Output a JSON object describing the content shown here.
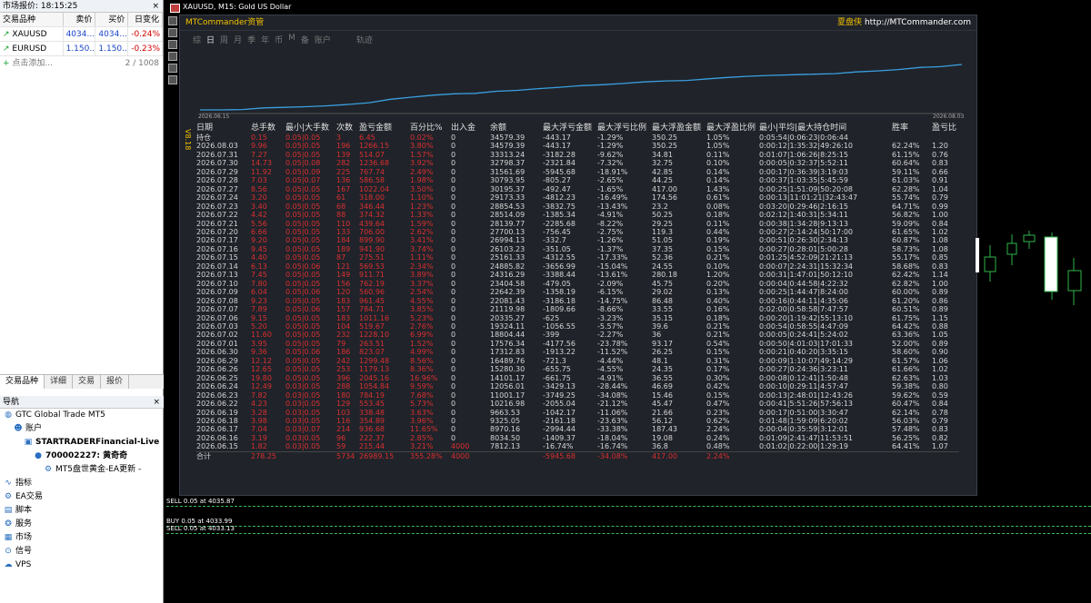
{
  "market_watch": {
    "title": "市场报价: 18:15:25",
    "close": "×",
    "headers": [
      "交易品种",
      "卖价",
      "买价",
      "日变化"
    ],
    "rows": [
      {
        "symbol": "XAUUSD",
        "bid": "4034...",
        "ask": "4034...",
        "change": "-0.24%"
      },
      {
        "symbol": "EURUSD",
        "bid": "1.150...",
        "ask": "1.150...",
        "change": "-0.23%"
      }
    ],
    "add": "点击添加...",
    "count": "2 / 1008",
    "tabs": [
      "交易品种",
      "详细",
      "交易",
      "报价"
    ]
  },
  "navigator": {
    "title": "导航",
    "close": "×",
    "items": [
      {
        "level": 0,
        "icon": "globe-icon",
        "label": "GTC Global Trade MT5"
      },
      {
        "level": 1,
        "icon": "accounts-icon",
        "label": "账户"
      },
      {
        "level": 2,
        "icon": "server-icon",
        "label": "STARTRADERFinancial-Live",
        "bold": true
      },
      {
        "level": 3,
        "icon": "user-icon",
        "label": "700002227: 黄奇奇",
        "bold": true
      },
      {
        "level": 4,
        "icon": "ea-icon",
        "label": "MT5盘世黄金-EA更新 -"
      },
      {
        "level": 0,
        "icon": "indicator-icon",
        "label": "指标"
      },
      {
        "level": 0,
        "icon": "ea-icon",
        "label": "EA交易"
      },
      {
        "level": 0,
        "icon": "script-icon",
        "label": "脚本"
      },
      {
        "level": 0,
        "icon": "service-icon",
        "label": "服务"
      },
      {
        "level": 0,
        "icon": "market-icon",
        "label": "市场"
      },
      {
        "level": 0,
        "icon": "signal-icon",
        "label": "信号"
      },
      {
        "level": 0,
        "icon": "vps-icon",
        "label": "VPS"
      }
    ]
  },
  "chart": {
    "title": "XAUUSD, M15:  Gold US Dollar"
  },
  "mtc": {
    "title": "MTCommander资管",
    "brand": "夏盘侠",
    "url": "http://MTCommander.com",
    "nav": [
      "综",
      "日",
      "周",
      "月",
      "季",
      "年",
      "币",
      "M",
      "备",
      "账户"
    ],
    "nav_selected": "日",
    "track": "轨迹",
    "date_start": "2026.06.15",
    "date_end": "2026.08.03",
    "version": "V8.18",
    "headers": [
      "日期",
      "总手数",
      "最小|大手数",
      "次数",
      "盈亏金额",
      "百分比%",
      "出入金",
      "余额",
      "最大浮亏金额",
      "最大浮亏比例",
      "最大浮盈金额",
      "最大浮盈比例",
      "最小|平均|最大持仓时间",
      "胜率",
      "盈亏比"
    ],
    "rows": [
      [
        "持仓",
        "0.15",
        "0.05|0.05",
        "3",
        "6.45",
        "0.02%",
        "0",
        "34579.39",
        "-443.17",
        "-1.29%",
        "350.25",
        "1.05%",
        "0:05:54|0:06:23|0:06:44",
        "",
        ""
      ],
      [
        "2026.08.03",
        "9.96",
        "0.05|0.05",
        "196",
        "1266.15",
        "3.80%",
        "0",
        "34579.39",
        "-443.17",
        "-1.29%",
        "350.25",
        "1.05%",
        "0:00:12|1:35:32|49:26:10",
        "62.24%",
        "1.20"
      ],
      [
        "2026.07.31",
        "7.27",
        "0.05|0.05",
        "139",
        "514.07",
        "1.57%",
        "0",
        "33313.24",
        "-3182.28",
        "-9.62%",
        "34.81",
        "0.11%",
        "0:01:07|1:06:26|8:25:15",
        "61.15%",
        "0.76"
      ],
      [
        "2026.07.30",
        "14.73",
        "0.05|0.08",
        "282",
        "1236.68",
        "3.92%",
        "0",
        "32798.37",
        "-2321.84",
        "-7.32%",
        "32.75",
        "0.10%",
        "0:00:05|0:32:37|5:52:11",
        "60.64%",
        "0.83"
      ],
      [
        "2026.07.29",
        "11.92",
        "0.05|0.09",
        "225",
        "767.74",
        "2.49%",
        "0",
        "31561.69",
        "-5945.68",
        "-18.91%",
        "42.85",
        "0.14%",
        "0:00:17|0:36:39|3:19:03",
        "59.11%",
        "0.66"
      ],
      [
        "2026.07.28",
        "7.03",
        "0.05|0.07",
        "136",
        "586.58",
        "1.98%",
        "0",
        "30793.95",
        "-805.27",
        "-2.65%",
        "44.25",
        "0.14%",
        "0:00:37|1:03:35|5:45:59",
        "61.03%",
        "0.91"
      ],
      [
        "2026.07.27",
        "8.56",
        "0.05|0.05",
        "167",
        "1022.04",
        "3.50%",
        "0",
        "30195.37",
        "-492.47",
        "-1.65%",
        "417.00",
        "1.43%",
        "0:00:25|1:51:09|50:20:08",
        "62.28%",
        "1.04"
      ],
      [
        "2026.07.24",
        "3.20",
        "0.05|0.05",
        "61",
        "318.00",
        "1.10%",
        "0",
        "29173.33",
        "-4812.23",
        "-16.49%",
        "174.56",
        "0.61%",
        "0:00:13|11:01:21|32:43:47",
        "55.74%",
        "0.79"
      ],
      [
        "2026.07.23",
        "3.40",
        "0.05|0.05",
        "68",
        "346.44",
        "1.23%",
        "0",
        "28854.53",
        "-3832.75",
        "-13.43%",
        "23.2",
        "0.08%",
        "0:03:20|0:29:46|2:16:15",
        "64.71%",
        "0.99"
      ],
      [
        "2026.07.22",
        "4.42",
        "0.05|0.05",
        "88",
        "374.32",
        "1.33%",
        "0",
        "28514.09",
        "-1385.34",
        "-4.91%",
        "50.25",
        "0.18%",
        "0:02:12|1:40:31|5:34:11",
        "56.82%",
        "1.00"
      ],
      [
        "2026.07.21",
        "5.56",
        "0.05|0.05",
        "110",
        "439.64",
        "1.59%",
        "0",
        "28139.77",
        "-2285.68",
        "-8.22%",
        "29.25",
        "0.11%",
        "0:00:38|1:34:28|9:13:13",
        "59.09%",
        "0.84"
      ],
      [
        "2026.07.20",
        "6.66",
        "0.05|0.05",
        "133",
        "706.00",
        "2.62%",
        "0",
        "27700.13",
        "-756.45",
        "-2.75%",
        "119.3",
        "0.44%",
        "0:00:27|2:14:24|50:17:00",
        "61.65%",
        "1.02"
      ],
      [
        "2026.07.17",
        "9.20",
        "0.05|0.05",
        "184",
        "899.90",
        "3.41%",
        "0",
        "26994.13",
        "-332.7",
        "-1.26%",
        "51.05",
        "0.19%",
        "0:00:51|0:26:30|2:34:13",
        "60.87%",
        "1.08"
      ],
      [
        "2026.07.16",
        "9.45",
        "0.05|0.05",
        "189",
        "941.90",
        "3.74%",
        "0",
        "26103.23",
        "-351.05",
        "-1.37%",
        "37.35",
        "0.15%",
        "0:00:27|0:28:01|5:00:28",
        "58.73%",
        "1.08"
      ],
      [
        "2026.07.15",
        "4.40",
        "0.05|0.05",
        "87",
        "275.51",
        "1.11%",
        "0",
        "25161.33",
        "-4312.55",
        "-17.33%",
        "52.36",
        "0.21%",
        "0:01:25|4:52:09|21:21:13",
        "55.17%",
        "0.85"
      ],
      [
        "2026.07.14",
        "6.13",
        "0.05|0.06",
        "121",
        "569.53",
        "2.34%",
        "0",
        "24885.82",
        "-3656.99",
        "-15.04%",
        "24.55",
        "0.10%",
        "0:00:07|2:24:31|15:32:34",
        "58.68%",
        "0.83"
      ],
      [
        "2026.07.13",
        "7.45",
        "0.05|0.05",
        "149",
        "911.71",
        "3.89%",
        "0",
        "24316.29",
        "-3388.44",
        "-13.61%",
        "280.18",
        "1.20%",
        "0:00:31|1:47:01|50:12:10",
        "62.42%",
        "1.14"
      ],
      [
        "2026.07.10",
        "7.80",
        "0.05|0.05",
        "156",
        "762.19",
        "3.37%",
        "0",
        "23404.58",
        "-479.05",
        "-2.09%",
        "45.75",
        "0.20%",
        "0:00:04|0:44:58|4:22:32",
        "62.82%",
        "1.00"
      ],
      [
        "2026.07.09",
        "6.04",
        "0.05|0.06",
        "120",
        "560.96",
        "2.54%",
        "0",
        "22642.39",
        "-1358.19",
        "-6.15%",
        "29.02",
        "0.13%",
        "0:00:25|1:44:47|8:24:00",
        "60.00%",
        "0.89"
      ],
      [
        "2026.07.08",
        "9.23",
        "0.05|0.05",
        "183",
        "961.45",
        "4.55%",
        "0",
        "22081.43",
        "-3186.18",
        "-14.75%",
        "86.48",
        "0.40%",
        "0:00:16|0:44:11|4:35:06",
        "61.20%",
        "0.86"
      ],
      [
        "2026.07.07",
        "7.89",
        "0.05|0.06",
        "157",
        "784.71",
        "3.85%",
        "0",
        "21119.98",
        "-1809.66",
        "-8.66%",
        "33.55",
        "0.16%",
        "0:02:00|0:58:58|7:47:57",
        "60.51%",
        "0.89"
      ],
      [
        "2026.07.06",
        "9.15",
        "0.05|0.05",
        "183",
        "1011.16",
        "5.23%",
        "0",
        "20335.27",
        "-625",
        "-3.23%",
        "35.15",
        "0.18%",
        "0:00:20|1:19:42|55:13:10",
        "61.75%",
        "1.15"
      ],
      [
        "2026.07.03",
        "5.20",
        "0.05|0.05",
        "104",
        "519.67",
        "2.76%",
        "0",
        "19324.11",
        "-1056.55",
        "-5.57%",
        "39.6",
        "0.21%",
        "0:00:54|0:58:55|4:47:09",
        "64.42%",
        "0.88"
      ],
      [
        "2026.07.02",
        "11.60",
        "0.05|0.05",
        "232",
        "1228.10",
        "6.99%",
        "0",
        "18804.44",
        "-399",
        "-2.27%",
        "36",
        "0.21%",
        "0:00:05|0:24:41|5:24:02",
        "63.36%",
        "1.05"
      ],
      [
        "2026.07.01",
        "3.95",
        "0.05|0.05",
        "79",
        "263.51",
        "1.52%",
        "0",
        "17576.34",
        "-4177.56",
        "-23.78%",
        "93.17",
        "0.54%",
        "0:00:50|4:01:03|17:01:33",
        "52.00%",
        "0.89"
      ],
      [
        "2026.06.30",
        "9.36",
        "0.05|0.06",
        "186",
        "823.07",
        "4.99%",
        "0",
        "17312.83",
        "-1913.22",
        "-11.52%",
        "26.25",
        "0.15%",
        "0:00:21|0:40:20|3:35:15",
        "58.60%",
        "0.90"
      ],
      [
        "2026.06.29",
        "12.12",
        "0.05|0.05",
        "242",
        "1299.48",
        "8.56%",
        "0",
        "16489.76",
        "-721.3",
        "-4.44%",
        "48.1",
        "0.31%",
        "0:00:09|1:10:07|49:14:29",
        "61.57%",
        "1.06"
      ],
      [
        "2026.06.26",
        "12.65",
        "0.05|0.05",
        "253",
        "1179.13",
        "8.36%",
        "0",
        "15280.30",
        "-655.75",
        "-4.55%",
        "24.35",
        "0.17%",
        "0:00:27|0:24:36|3:23:11",
        "61.66%",
        "1.02"
      ],
      [
        "2026.06.25",
        "19.80",
        "0.05|0.05",
        "396",
        "2045.16",
        "16.96%",
        "0",
        "14101.17",
        "-661.75",
        "-4.91%",
        "36.55",
        "0.30%",
        "0:00:08|0:12:41|1:50:48",
        "62.63%",
        "1.03"
      ],
      [
        "2026.06.24",
        "12.49",
        "0.03|0.05",
        "288",
        "1054.84",
        "9.59%",
        "0",
        "12056.01",
        "-3429.13",
        "-28.44%",
        "46.69",
        "0.42%",
        "0:00:10|0:29:11|4:57:47",
        "59.38%",
        "0.80"
      ],
      [
        "2026.06.23",
        "7.82",
        "0.03|0.05",
        "180",
        "784.19",
        "7.68%",
        "0",
        "11001.17",
        "-3749.25",
        "-34.08%",
        "15.46",
        "0.15%",
        "0:00:13|2:48:01|12:43:26",
        "59.62%",
        "0.59"
      ],
      [
        "2026.06.22",
        "4.23",
        "0.03|0.05",
        "129",
        "553.45",
        "5.73%",
        "0",
        "10216.98",
        "-2055.04",
        "-21.12%",
        "45.47",
        "0.47%",
        "0:00:41|5:51:26|57:56:13",
        "60.47%",
        "0.84"
      ],
      [
        "2026.06.19",
        "3.28",
        "0.03|0.05",
        "103",
        "338.48",
        "3.63%",
        "0",
        "9663.53",
        "-1042.17",
        "-11.06%",
        "21.66",
        "0.23%",
        "0:00:17|0:51:00|3:30:47",
        "62.14%",
        "0.78"
      ],
      [
        "2026.06.18",
        "3.98",
        "0.03|0.05",
        "116",
        "354.89",
        "3.96%",
        "0",
        "9325.05",
        "-2161.18",
        "-23.63%",
        "56.12",
        "0.62%",
        "0:01:48|1:59:09|6:20:02",
        "56.03%",
        "0.79"
      ],
      [
        "2026.06.17",
        "7.04",
        "0.03|0.07",
        "214",
        "936.68",
        "11.65%",
        "0",
        "8970.16",
        "-2994.44",
        "-33.38%",
        "187.43",
        "2.24%",
        "0:00:04|0:35:59|3:12:01",
        "57.48%",
        "0.83"
      ],
      [
        "2026.06.16",
        "3.19",
        "0.03|0.05",
        "96",
        "222.37",
        "2.85%",
        "0",
        "8034.50",
        "-1409.37",
        "-18.04%",
        "19.08",
        "0.24%",
        "0:01:09|2:41:47|11:53:51",
        "56.25%",
        "0.82"
      ],
      [
        "2026.06.15",
        "1.82",
        "0.03|0.05",
        "59",
        "215.44",
        "3.21%",
        "4000",
        "7812.13",
        "-16.74%",
        "-16.74%",
        "36.8",
        "0.48%",
        "0:01:02|0:22:00|1:29:19",
        "64.41%",
        "1.07"
      ]
    ],
    "total": [
      "合计",
      "278.25",
      "",
      "5734",
      "26989.15",
      "355.28%",
      "4000",
      "",
      "-5945.68",
      "-34.08%",
      "417.00",
      "2.24%",
      "",
      "",
      ""
    ]
  },
  "orders": [
    "SELL 0.05 at 4035.87",
    "BUY 0.05 at 4033.99",
    "SELL 0.05 at 4033.13"
  ],
  "colors": {
    "panel_bg": "#20232a",
    "accent": "#f2c200",
    "loss": "#d9302f",
    "curve": "#3aa0e0",
    "order_line": "#3dba5a"
  }
}
